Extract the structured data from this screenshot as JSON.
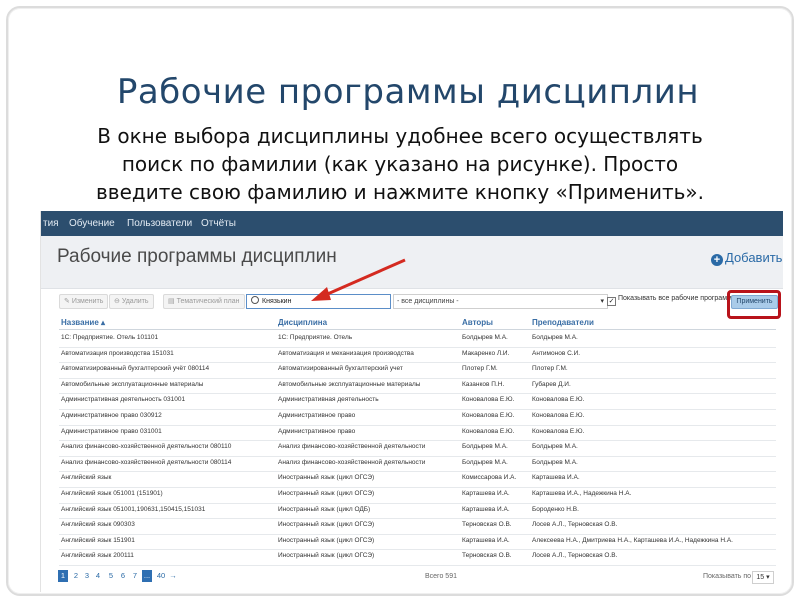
{
  "slide": {
    "title": "Рабочие программы дисциплин",
    "body_lines": [
      "В окне выбора дисциплины удобнее всего осуществлять",
      "поиск по фамилии (как указано на рисунке). Просто",
      "введите свою фамилию и нажмите кнопку «Применить»."
    ]
  },
  "app": {
    "nav": [
      "тия",
      "Обучение",
      "Пользователи",
      "Отчёты"
    ],
    "page_title": "Рабочие программы дисциплин",
    "add_label": "Добавить",
    "toolbar": {
      "edit_label": "Изменить",
      "delete_label": "Удалить",
      "plan_label": "Тематический план",
      "search_value": "Князькин",
      "select_value": "- все дисциплины -",
      "show_all_label": "Показывать все рабочие программы",
      "show_all_checked": true,
      "apply_label": "Применить"
    },
    "columns": [
      "Название ▴",
      "Дисциплина",
      "Авторы",
      "Преподаватели"
    ],
    "rows": [
      [
        "1С: Предприятие. Отель 101101",
        "1С: Предприятие. Отель",
        "Болдырев М.А.",
        "Болдырев М.А."
      ],
      [
        "Автоматизация производства 151031",
        "Автоматизация и механизация производства",
        "Макаренко Л.И.",
        "Антимонов С.И."
      ],
      [
        "Автоматизированный бухгалтерский учёт 080114",
        "Автоматизированный бухгалтерский учет",
        "Плотер Г.М.",
        "Плотер Г.М."
      ],
      [
        "Автомобильные эксплуатационные материалы",
        "Автомобильные эксплуатационные материалы",
        "Казанков П.Н.",
        "Губарев Д.И."
      ],
      [
        "Административная деятельность 031001",
        "Административная деятельность",
        "Коновалова Е.Ю.",
        "Коновалова Е.Ю."
      ],
      [
        "Административное право 030912",
        "Административное право",
        "Коновалова Е.Ю.",
        "Коновалова Е.Ю."
      ],
      [
        "Административное право 031001",
        "Административное право",
        "Коновалова Е.Ю.",
        "Коновалова Е.Ю."
      ],
      [
        "Анализ финансово-хозяйственной деятельности 080110",
        "Анализ финансово-хозяйственной деятельности",
        "Болдырев М.А.",
        "Болдырев М.А."
      ],
      [
        "Анализ финансово-хозяйственной деятельности 080114",
        "Анализ финансово-хозяйственной деятельности",
        "Болдырев М.А.",
        "Болдырев М.А."
      ],
      [
        "Английский язык",
        "Иностранный язык (цикл ОГСЭ)",
        "Комиссарова И.А.",
        "Карташева И.А."
      ],
      [
        "Английский язык 051001 (151901)",
        "Иностранный язык (цикл ОГСЭ)",
        "Карташева И.А.",
        "Карташева И.А., Надежкина Н.А."
      ],
      [
        "Английский язык 051001,190631,150415,151031",
        "Иностранный язык (цикл ОДБ)",
        "Карташева И.А.",
        "Бороденко Н.В."
      ],
      [
        "Английский язык 090303",
        "Иностранный язык (цикл ОГСЭ)",
        "Терновская О.В.",
        "Лосев А.Л., Терновская О.В."
      ],
      [
        "Английский язык 151901",
        "Иностранный язык (цикл ОГСЭ)",
        "Карташева И.А.",
        "Алексеева Н.А., Дмитриева Н.А., Карташева И.А., Надежкина Н.А."
      ],
      [
        "Английский язык 200111",
        "Иностранный язык (цикл ОГСЭ)",
        "Терновская О.В.",
        "Лосев А.Л., Терновская О.В."
      ]
    ],
    "pager": {
      "pages": [
        "1",
        "2",
        "3",
        "4",
        "5",
        "6",
        "7",
        "...",
        "40",
        "→"
      ],
      "active": "1"
    },
    "total_label": "Всего 591",
    "per_page_label": "Показывать по",
    "per_page_value": "15 ▾"
  },
  "colors": {
    "title": "#23476b",
    "navbar": "#2c4e6e",
    "highlight": "#b8131b",
    "apply": "#a9cbe9"
  }
}
